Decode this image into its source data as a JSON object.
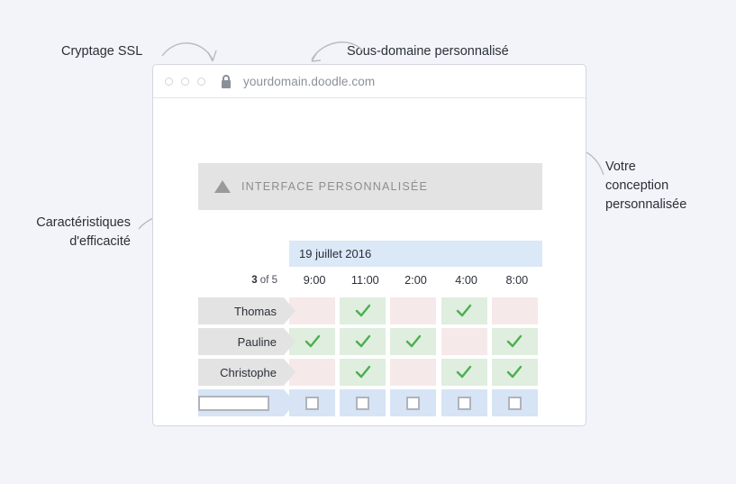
{
  "annotations": {
    "ssl": "Cryptage SSL",
    "subdomain": "Sous-domaine personnalisé",
    "features": "Caractéristiques\nd'efficacité",
    "design": "Votre\nconception\npersonnalisée"
  },
  "browser": {
    "url": "yourdomain.doodle.com",
    "lock_icon": "lock-icon",
    "dots": [
      "window-dot",
      "window-dot",
      "window-dot"
    ]
  },
  "banner": {
    "icon": "triangle-up-icon",
    "text": "INTERFACE PERSONNALISÉE"
  },
  "poll": {
    "date_label": "19 juillet 2016",
    "count_prefix": "3",
    "count_suffix": " of 5",
    "times": [
      "9:00",
      "11:00",
      "2:00",
      "4:00",
      "8:00"
    ],
    "participants": [
      {
        "name": "Thomas",
        "votes": [
          "no",
          "yes",
          "no",
          "yes",
          "no"
        ]
      },
      {
        "name": "Pauline",
        "votes": [
          "yes",
          "yes",
          "yes",
          "no",
          "yes"
        ]
      },
      {
        "name": "Christophe",
        "votes": [
          "no",
          "yes",
          "no",
          "yes",
          "yes"
        ]
      }
    ],
    "vote_row": {
      "name_placeholder": "",
      "name_value": "",
      "checkboxes": [
        false,
        false,
        false,
        false,
        false
      ]
    }
  },
  "colors": {
    "page_background": "#f2f4f9",
    "yes_cell": "#dfeedf",
    "no_cell": "#f6e9e9",
    "vote_cell": "#d6e4f5",
    "check_mark": "#4caf50",
    "tag": "#e3e3e3",
    "date_header": "#dbe8f7",
    "banner": "#e3e3e3"
  }
}
